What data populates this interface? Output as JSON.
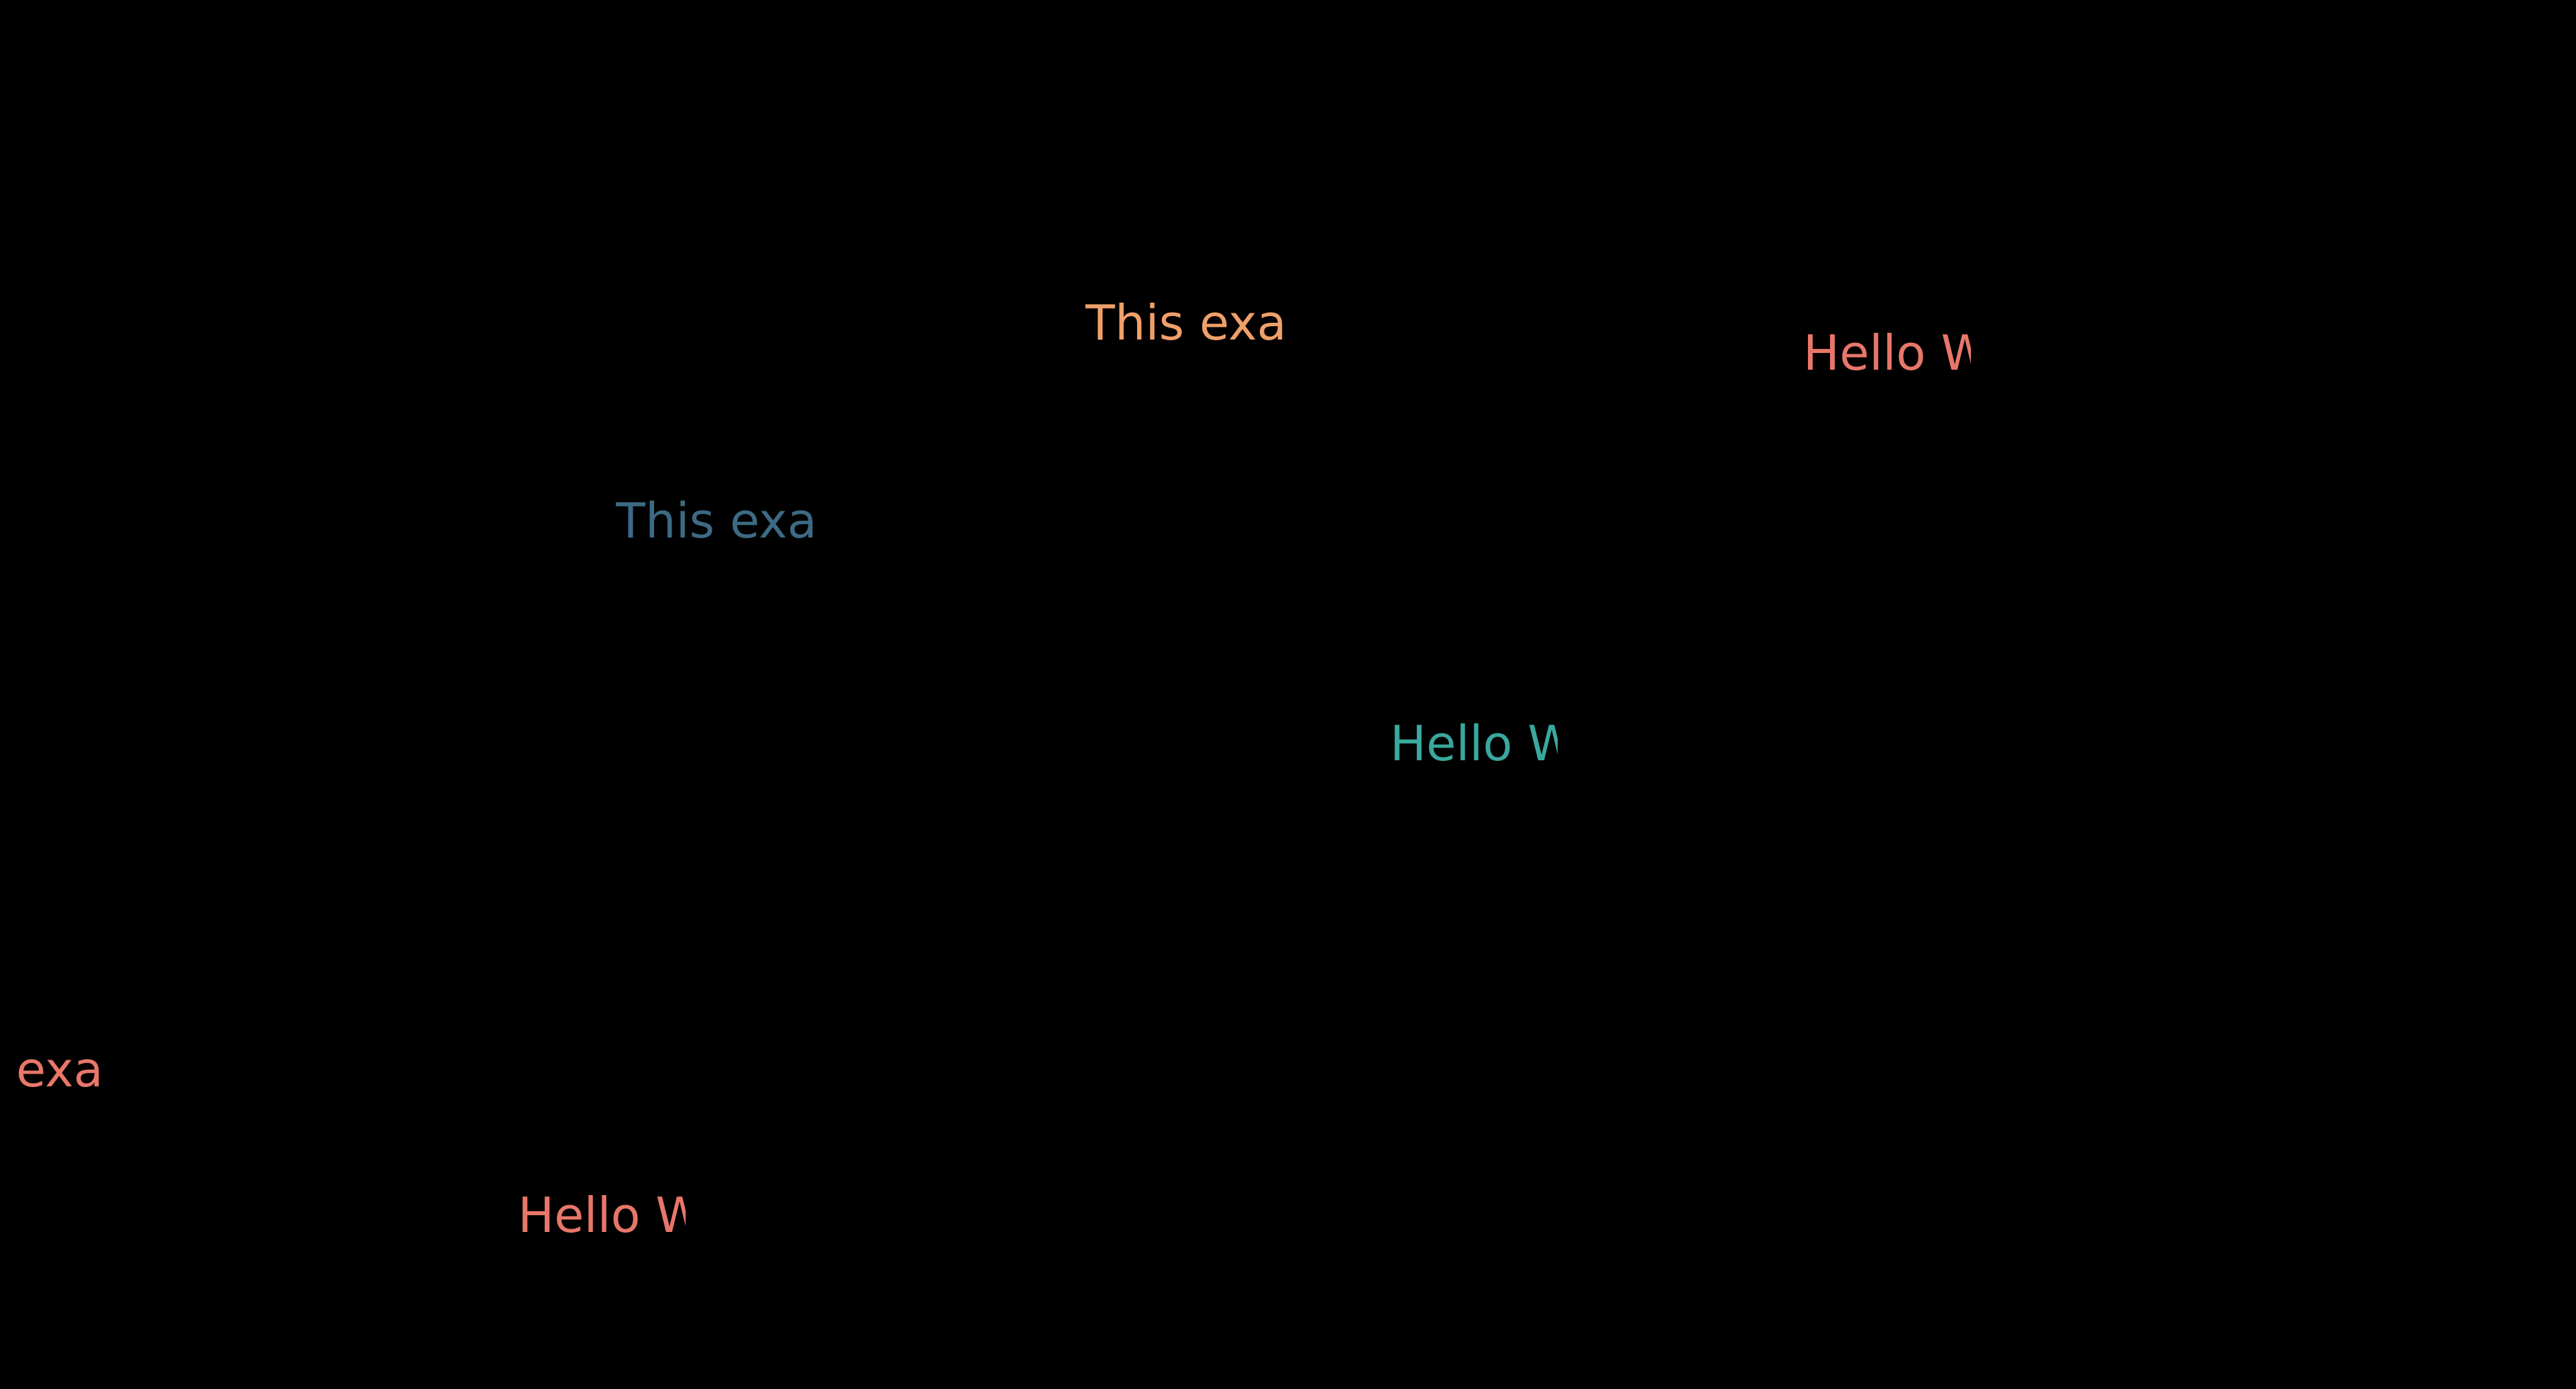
{
  "labels": [
    {
      "text": "This exa",
      "color": "#f0a06a"
    },
    {
      "text": "Hello W",
      "color": "#e8776a"
    },
    {
      "text": "This exa",
      "color": "#3d6a84"
    },
    {
      "text": "Hello W",
      "color": "#3aa89e"
    },
    {
      "text": "exa",
      "color": "#e8776a"
    },
    {
      "text": "Hello W",
      "color": "#e8776a"
    }
  ],
  "background": "#000000"
}
